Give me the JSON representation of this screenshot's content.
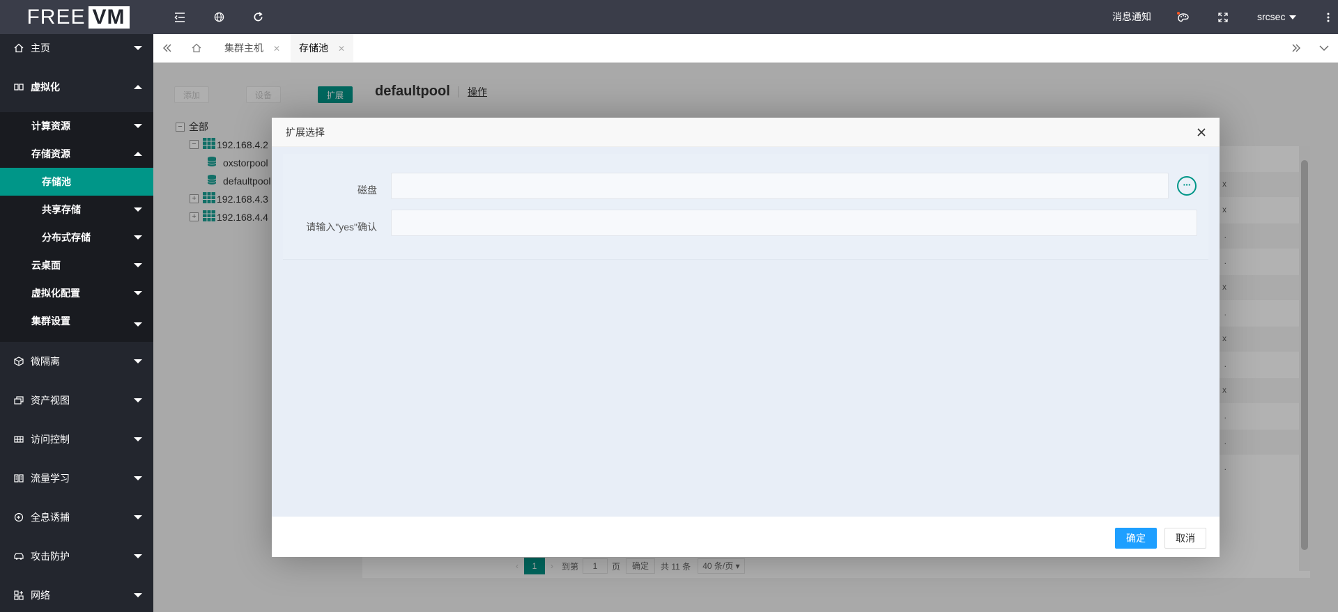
{
  "brand": {
    "free": "FREE",
    "vm": "VM"
  },
  "sidebar": {
    "home": {
      "label": "主页",
      "icon": "home-icon"
    },
    "virtualization": {
      "label": "虚拟化",
      "icon": "columns-icon",
      "compute": "计算资源",
      "storage": "存储资源",
      "storage_pool": "存储池",
      "shared_storage": "共享存储",
      "distributed_storage": "分布式存储",
      "cloud_desktop": "云桌面",
      "virt_config": "虚拟化配置",
      "cluster_settings": "集群设置"
    },
    "micro_isolation": "微隔离",
    "asset_view": "资产视图",
    "access_control": "访问控制",
    "traffic_learning": "流量学习",
    "honeypot": "全息诱捕",
    "attack_defense": "攻击防护",
    "network": "网络"
  },
  "header": {
    "notifications": "消息通知",
    "user": "srcsec"
  },
  "tabs": {
    "cluster_host": "集群主机",
    "storage_pool": "存储池"
  },
  "page": {
    "btn_add": "添加",
    "btn_set": "设备",
    "btn_expand": "扩展",
    "tree": {
      "root": "全部",
      "host1": "192.168.4.2",
      "pool1": "oxstorpool",
      "pool2": "defaultpool",
      "host2": "192.168.4.3",
      "host3": "192.168.4.4"
    },
    "title": "defaultpool",
    "op": "操作",
    "row_marks": [
      "",
      "x",
      "x",
      ".",
      ".",
      "x",
      ".",
      "x",
      ".",
      "x",
      ".",
      ".",
      "."
    ],
    "pager": {
      "current": "1",
      "goto": "到第",
      "page_input": "1",
      "page_unit": "页",
      "confirm": "确定",
      "total": "共 11 条",
      "per_page": "40 条/页"
    }
  },
  "modal": {
    "title": "扩展选择",
    "disk_label": "磁盘",
    "disk_value": "",
    "confirm_label": "请输入\"yes\"确认",
    "confirm_value": "",
    "ok": "确定",
    "cancel": "取消"
  }
}
